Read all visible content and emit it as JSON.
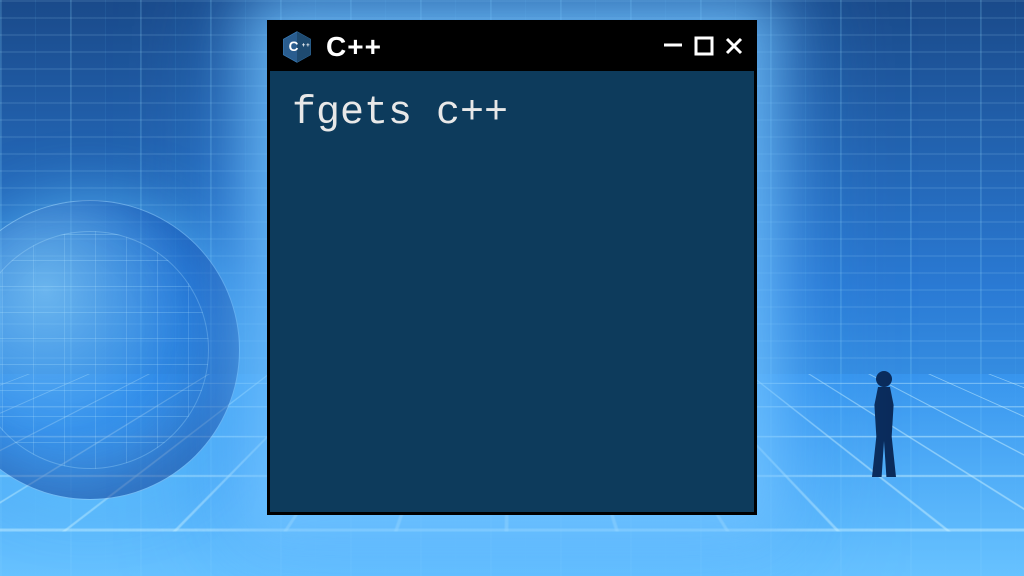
{
  "window": {
    "title": "C++",
    "logo": "cpp-hexagon",
    "controls": {
      "minimize": "—",
      "maximize": "☐",
      "close": "✕"
    }
  },
  "terminal": {
    "content": "fgets c++"
  },
  "colors": {
    "terminal_bg": "#0d3b5c",
    "titlebar_bg": "#000000",
    "text": "#e8e8e8"
  }
}
